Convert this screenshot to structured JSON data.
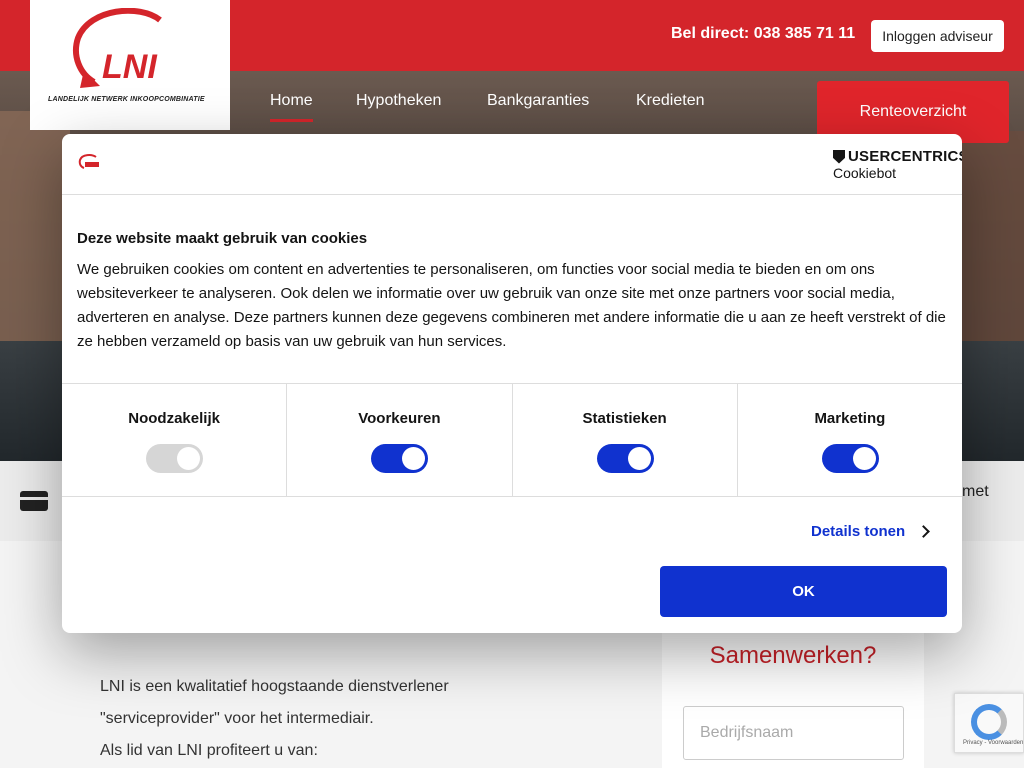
{
  "header": {
    "phone": "Bel direct: 038 385 71 11",
    "login_label": "Inloggen adviseur",
    "logo_text": "LNI",
    "logo_tagline": "Landelijk Netwerk Inkoopcombinatie"
  },
  "nav": {
    "items": [
      "Home",
      "Hypotheken",
      "Bankgaranties",
      "Kredieten"
    ],
    "active": "Home",
    "cta": "Renteoverzicht"
  },
  "strip": {
    "partial_text": "met"
  },
  "content": {
    "paragraphs": [
      "LNI is een kwalitatief hoogstaande dienstverlener",
      "\"serviceprovider\" voor het intermediair.",
      "Als lid van LNI profiteert u van:"
    ],
    "side_title": "Samenwerken?",
    "company_placeholder": "Bedrijfsnaam",
    "recaptcha_text": "Privacy - Voorwaarden"
  },
  "cookie": {
    "brand_line1": "USERCENTRICS",
    "brand_line2": "Cookiebot",
    "title": "Deze website maakt gebruik van cookies",
    "body": "We gebruiken cookies om content en advertenties te personaliseren, om functies voor social media te bieden en om ons websiteverkeer te analyseren. Ook delen we informatie over uw gebruik van onze site met onze partners voor social media, adverteren en analyse. Deze partners kunnen deze gegevens combineren met andere informatie die u aan ze heeft verstrekt of die ze hebben verzameld op basis van uw gebruik van hun services.",
    "categories": [
      {
        "label": "Noodzakelijk",
        "on": true,
        "disabled": true
      },
      {
        "label": "Voorkeuren",
        "on": true,
        "disabled": false
      },
      {
        "label": "Statistieken",
        "on": true,
        "disabled": false
      },
      {
        "label": "Marketing",
        "on": true,
        "disabled": false
      }
    ],
    "details_label": "Details tonen",
    "ok_label": "OK"
  },
  "colors": {
    "brand_red": "#d4252b",
    "cookie_blue": "#1032cf"
  }
}
